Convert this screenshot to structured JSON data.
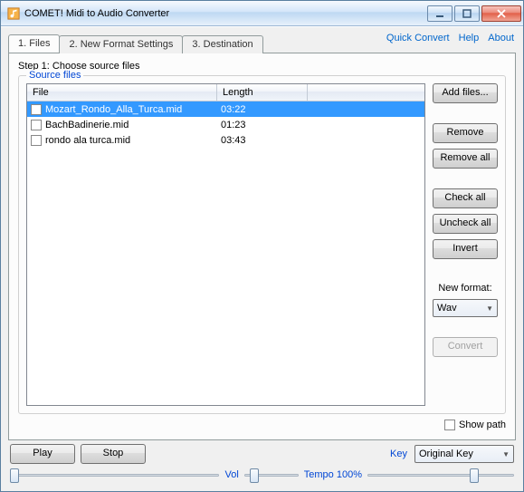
{
  "window": {
    "title": "COMET! Midi to Audio Converter"
  },
  "links": {
    "quick": "Quick Convert",
    "help": "Help",
    "about": "About"
  },
  "tabs": {
    "t1": "1. Files",
    "t2": "2. New Format Settings",
    "t3": "3. Destination"
  },
  "step_label": "Step 1: Choose source files",
  "fieldset_label": "Source files",
  "columns": {
    "file": "File",
    "length": "Length"
  },
  "files": [
    {
      "name": "Mozart_Rondo_Alla_Turca.mid",
      "len": "03:22",
      "selected": true
    },
    {
      "name": "BachBadinerie.mid",
      "len": "01:23",
      "selected": false
    },
    {
      "name": "rondo ala turca.mid",
      "len": "03:43",
      "selected": false
    }
  ],
  "buttons": {
    "addfiles": "Add files...",
    "remove": "Remove",
    "removeall": "Remove all",
    "checkall": "Check all",
    "uncheckall": "Uncheck all",
    "invert": "Invert",
    "convert": "Convert",
    "play": "Play",
    "stop": "Stop"
  },
  "newformat": {
    "label": "New format:",
    "value": "Wav"
  },
  "showpath_label": "Show path",
  "key": {
    "label": "Key",
    "value": "Original Key"
  },
  "vol_label": "Vol",
  "tempo_label": "Tempo 100%"
}
